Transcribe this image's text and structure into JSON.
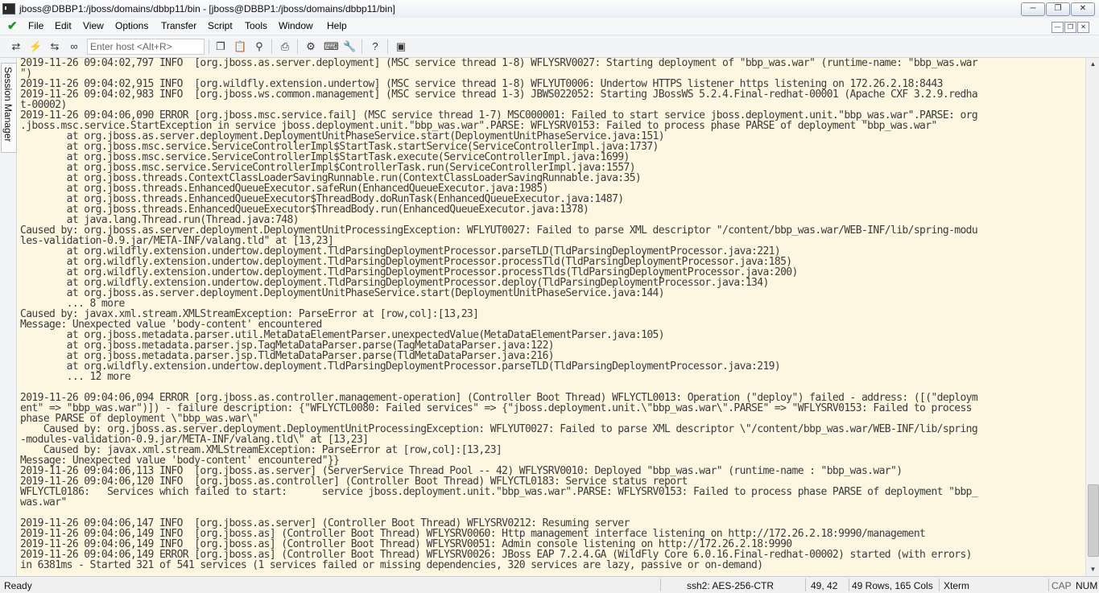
{
  "window": {
    "title": "jboss@DBBP1:/jboss/domains/dbbp11/bin - [jboss@DBBP1:/jboss/domains/dbbp11/bin]",
    "app_icon": "terminal-icon",
    "buttons": {
      "minimize": "minimize-icon",
      "restore": "restore-icon",
      "close": "close-icon"
    }
  },
  "menubar": {
    "status_icon": "green-check-icon",
    "items": [
      "File",
      "Edit",
      "View",
      "Options",
      "Transfer",
      "Script",
      "Tools",
      "Window",
      "Help"
    ]
  },
  "toolbar": {
    "host_placeholder": "Enter host <Alt+R>",
    "icons": [
      "connect-icon",
      "quick-connect-icon",
      "reconnect-icon",
      "disconnect-icon",
      "copy-icon",
      "paste-icon",
      "copy-paste-icon",
      "find-icon",
      "print-icon",
      "settings-icon",
      "keymap-icon",
      "sftp-icon",
      "help-icon",
      "screen-icon"
    ]
  },
  "sidebar": {
    "tab_label": "Session Manager"
  },
  "terminal": {
    "bg_color": "#fdf6e0",
    "text_color": "#3b3b3b",
    "lines": [
      "2019-11-26 09:04:02,797 INFO  [org.jboss.as.server.deployment] (MSC service thread 1-8) WFLYSRV0027: Starting deployment of \"bbp_was.war\" (runtime-name: \"bbp_was.war",
      "\")",
      "2019-11-26 09:04:02,915 INFO  [org.wildfly.extension.undertow] (MSC service thread 1-8) WFLYUT0006: Undertow HTTPS listener https listening on 172.26.2.18:8443",
      "2019-11-26 09:04:02,983 INFO  [org.jboss.ws.common.management] (MSC service thread 1-3) JBWS022052: Starting JBossWS 5.2.4.Final-redhat-00001 (Apache CXF 3.2.9.redha",
      "t-00002)",
      "2019-11-26 09:04:06,090 ERROR [org.jboss.msc.service.fail] (MSC service thread 1-7) MSC000001: Failed to start service jboss.deployment.unit.\"bbp_was.war\".PARSE: org",
      ".jboss.msc.service.StartException in service jboss.deployment.unit.\"bbp_was.war\".PARSE: WFLYSRV0153: Failed to process phase PARSE of deployment \"bbp_was.war\"",
      "        at org.jboss.as.server.deployment.DeploymentUnitPhaseService.start(DeploymentUnitPhaseService.java:151)",
      "        at org.jboss.msc.service.ServiceControllerImpl$StartTask.startService(ServiceControllerImpl.java:1737)",
      "        at org.jboss.msc.service.ServiceControllerImpl$StartTask.execute(ServiceControllerImpl.java:1699)",
      "        at org.jboss.msc.service.ServiceControllerImpl$ControllerTask.run(ServiceControllerImpl.java:1557)",
      "        at org.jboss.threads.ContextClassLoaderSavingRunnable.run(ContextClassLoaderSavingRunnable.java:35)",
      "        at org.jboss.threads.EnhancedQueueExecutor.safeRun(EnhancedQueueExecutor.java:1985)",
      "        at org.jboss.threads.EnhancedQueueExecutor$ThreadBody.doRunTask(EnhancedQueueExecutor.java:1487)",
      "        at org.jboss.threads.EnhancedQueueExecutor$ThreadBody.run(EnhancedQueueExecutor.java:1378)",
      "        at java.lang.Thread.run(Thread.java:748)",
      "Caused by: org.jboss.as.server.deployment.DeploymentUnitProcessingException: WFLYUT0027: Failed to parse XML descriptor \"/content/bbp_was.war/WEB-INF/lib/spring-modu",
      "les-validation-0.9.jar/META-INF/valang.tld\" at [13,23]",
      "        at org.wildfly.extension.undertow.deployment.TldParsingDeploymentProcessor.parseTLD(TldParsingDeploymentProcessor.java:221)",
      "        at org.wildfly.extension.undertow.deployment.TldParsingDeploymentProcessor.processTld(TldParsingDeploymentProcessor.java:185)",
      "        at org.wildfly.extension.undertow.deployment.TldParsingDeploymentProcessor.processTlds(TldParsingDeploymentProcessor.java:200)",
      "        at org.wildfly.extension.undertow.deployment.TldParsingDeploymentProcessor.deploy(TldParsingDeploymentProcessor.java:134)",
      "        at org.jboss.as.server.deployment.DeploymentUnitPhaseService.start(DeploymentUnitPhaseService.java:144)",
      "        ... 8 more",
      "Caused by: javax.xml.stream.XMLStreamException: ParseError at [row,col]:[13,23]",
      "Message: Unexpected value 'body-content' encountered",
      "        at org.jboss.metadata.parser.util.MetaDataElementParser.unexpectedValue(MetaDataElementParser.java:105)",
      "        at org.jboss.metadata.parser.jsp.TagMetaDataParser.parse(TagMetaDataParser.java:122)",
      "        at org.jboss.metadata.parser.jsp.TldMetaDataParser.parse(TldMetaDataParser.java:216)",
      "        at org.wildfly.extension.undertow.deployment.TldParsingDeploymentProcessor.parseTLD(TldParsingDeploymentProcessor.java:219)",
      "        ... 12 more",
      "",
      "2019-11-26 09:04:06,094 ERROR [org.jboss.as.controller.management-operation] (Controller Boot Thread) WFLYCTL0013: Operation (\"deploy\") failed - address: ([(\"deploym",
      "ent\" => \"bbp_was.war\")]) - failure description: {\"WFLYCTL0080: Failed services\" => {\"jboss.deployment.unit.\\\"bbp_was.war\\\".PARSE\" => \"WFLYSRV0153: Failed to process",
      "phase PARSE of deployment \\\"bbp_was.war\\\"",
      "    Caused by: org.jboss.as.server.deployment.DeploymentUnitProcessingException: WFLYUT0027: Failed to parse XML descriptor \\\"/content/bbp_was.war/WEB-INF/lib/spring",
      "-modules-validation-0.9.jar/META-INF/valang.tld\\\" at [13,23]",
      "    Caused by: javax.xml.stream.XMLStreamException: ParseError at [row,col]:[13,23]",
      "Message: Unexpected value 'body-content' encountered\"}}",
      "2019-11-26 09:04:06,113 INFO  [org.jboss.as.server] (ServerService Thread Pool -- 42) WFLYSRV0010: Deployed \"bbp_was.war\" (runtime-name : \"bbp_was.war\")",
      "2019-11-26 09:04:06,120 INFO  [org.jboss.as.controller] (Controller Boot Thread) WFLYCTL0183: Service status report",
      "WFLYCTL0186:   Services which failed to start:      service jboss.deployment.unit.\"bbp_was.war\".PARSE: WFLYSRV0153: Failed to process phase PARSE of deployment \"bbp_",
      "was.war\"",
      "",
      "2019-11-26 09:04:06,147 INFO  [org.jboss.as.server] (Controller Boot Thread) WFLYSRV0212: Resuming server",
      "2019-11-26 09:04:06,149 INFO  [org.jboss.as] (Controller Boot Thread) WFLYSRV0060: Http management interface listening on http://172.26.2.18:9990/management",
      "2019-11-26 09:04:06,149 INFO  [org.jboss.as] (Controller Boot Thread) WFLYSRV0051: Admin console listening on http://172.26.2.18:9990",
      "2019-11-26 09:04:06,149 ERROR [org.jboss.as] (Controller Boot Thread) WFLYSRV0026: JBoss EAP 7.2.4.GA (WildFly Core 6.0.16.Final-redhat-00002) started (with errors)",
      "in 6381ms - Started 321 of 541 services (1 services failed or missing dependencies, 320 services are lazy, passive or on-demand)"
    ]
  },
  "statusbar": {
    "status": "Ready",
    "protocol": "ssh2: AES-256-CTR",
    "cursor": "49,  42",
    "size": "49 Rows, 165 Cols",
    "terminal_type": "Xterm",
    "cap": "CAP",
    "num": "NUM"
  }
}
